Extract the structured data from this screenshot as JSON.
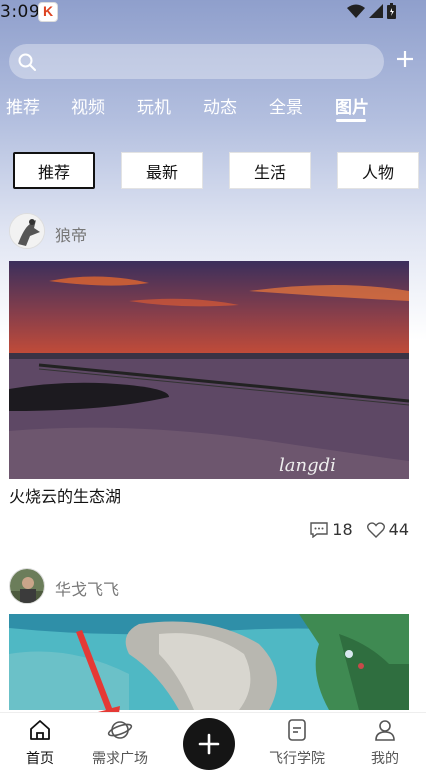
{
  "status_bar": {
    "time": "3:09"
  },
  "search": {
    "placeholder": ""
  },
  "category_tabs": [
    {
      "label": "推荐",
      "active": false
    },
    {
      "label": "视频",
      "active": false
    },
    {
      "label": "玩机",
      "active": false
    },
    {
      "label": "动态",
      "active": false
    },
    {
      "label": "全景",
      "active": false
    },
    {
      "label": "图片",
      "active": true
    }
  ],
  "filter_chips": [
    {
      "label": "推荐",
      "active": true
    },
    {
      "label": "最新",
      "active": false
    },
    {
      "label": "生活",
      "active": false
    },
    {
      "label": "人物",
      "active": false
    }
  ],
  "posts": [
    {
      "author": "狼帝",
      "title": "火烧云的生态湖",
      "watermark": "langdi",
      "comments": "18",
      "likes": "44"
    },
    {
      "author": "华戈飞飞"
    }
  ],
  "bottom_nav": [
    {
      "label": "首页",
      "icon": "home-icon",
      "active": true
    },
    {
      "label": "需求广场",
      "icon": "planet-icon",
      "active": false
    },
    {
      "label": "飞行学院",
      "icon": "document-icon",
      "active": false
    },
    {
      "label": "我的",
      "icon": "user-icon",
      "active": false
    }
  ],
  "colors": {
    "accent": "#151515",
    "tab_text": "#ffffff",
    "annotation_arrow": "#e53935"
  }
}
